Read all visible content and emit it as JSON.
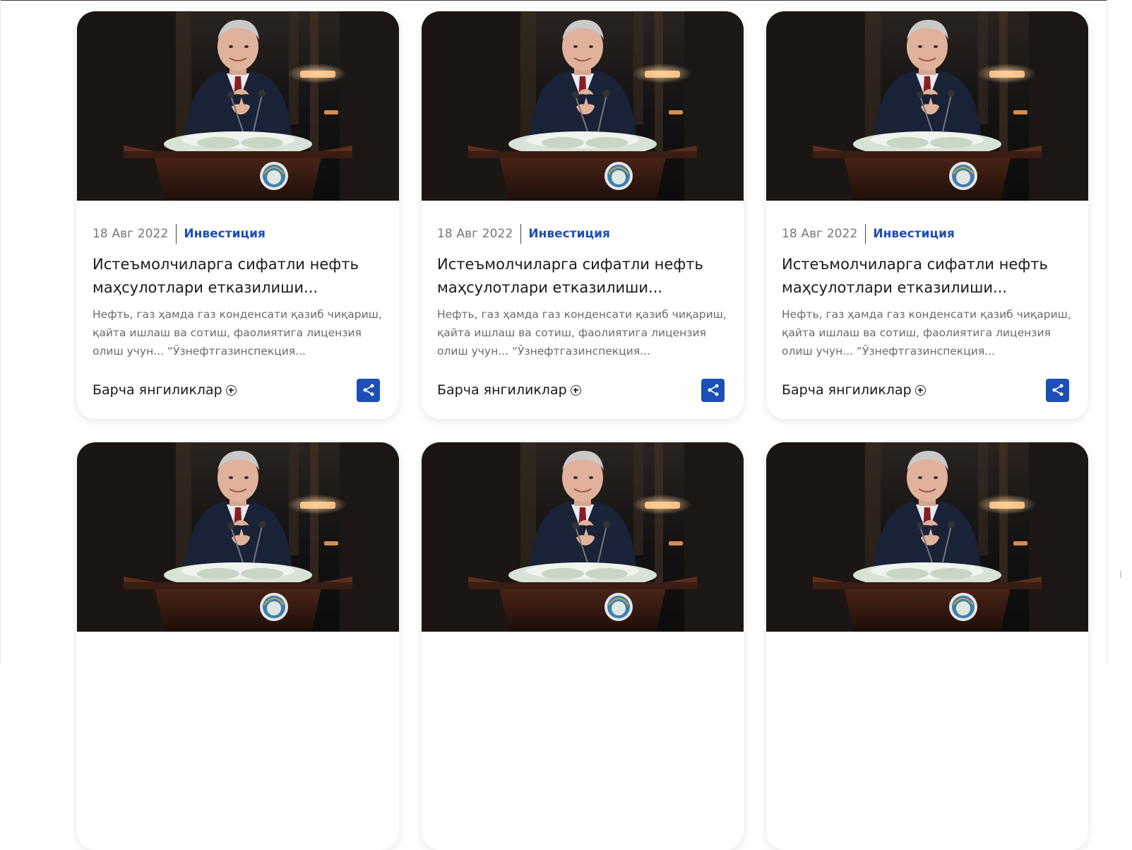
{
  "cards": [
    {
      "date": "18 Авг 2022",
      "category": "Инвестиция",
      "title": "Истеъмолчиларга сифатли нефть маҳсулотлари етказилиши...",
      "excerpt": "Нефть, газ ҳамда газ конденсати қазиб чиқариш, қайта ишлаш ва сотиш, фаолиятига лицензия олиш учун... “Ўзнефтгазинспекция...",
      "all_news_label": "Барча янгиликлар"
    },
    {
      "date": "18 Авг 2022",
      "category": "Инвестиция",
      "title": "Истеъмолчиларга сифатли нефть маҳсулотлари етказилиши...",
      "excerpt": "Нефть, газ ҳамда газ конденсати қазиб чиқариш, қайта ишлаш ва сотиш, фаолиятига лицензия олиш учун... “Ўзнефтгазинспекция...",
      "all_news_label": "Барча янгиликлар"
    },
    {
      "date": "18 Авг 2022",
      "category": "Инвестиция",
      "title": "Истеъмолчиларга сифатли нефть маҳсулотлари етказилиши...",
      "excerpt": "Нефть, газ ҳамда газ конденсати қазиб чиқариш, қайта ишлаш ва сотиш, фаолиятига лицензия олиш учун... “Ўзнефтгазинспекция...",
      "all_news_label": "Барча янгиликлар"
    },
    {},
    {},
    {}
  ],
  "icons": {
    "share": "share-icon",
    "plus": "plus-circle-icon"
  },
  "colors": {
    "accent": "#1d4fb8",
    "date": "#777777",
    "excerpt": "#6b6b6b",
    "title": "#1a1a1a"
  }
}
